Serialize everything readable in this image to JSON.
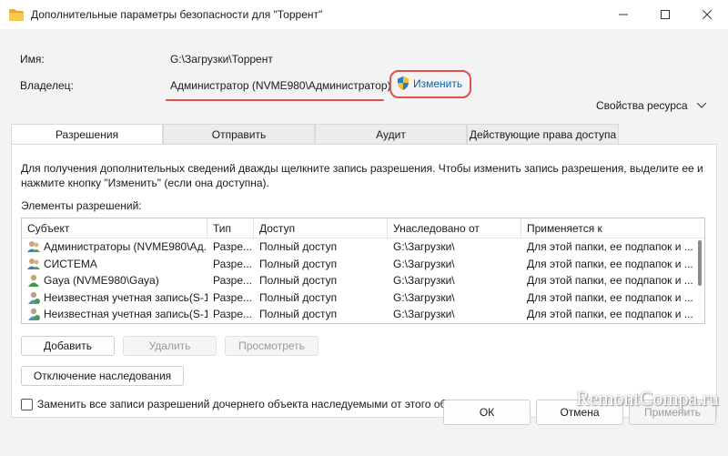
{
  "window": {
    "title": "Дополнительные параметры безопасности  для \"Торрент\"",
    "title_icon": "folder-icon",
    "controls": [
      "minimize-icon",
      "maximize-icon",
      "close-icon"
    ]
  },
  "info": {
    "name_label": "Имя:",
    "name_value": "G:\\Загрузки\\Торрент",
    "owner_label": "Владелец:",
    "owner_value": "Администратор (NVME980\\Администратор)",
    "change_link": "Изменить",
    "resource_props": "Свойства ресурса"
  },
  "tabs": [
    {
      "label": "Разрешения",
      "active": true
    },
    {
      "label": "Отправить",
      "active": false
    },
    {
      "label": "Аудит",
      "active": false
    },
    {
      "label": "Действующие права доступа",
      "active": false
    }
  ],
  "panel": {
    "description": "Для получения дополнительных сведений дважды щелкните запись разрешения. Чтобы изменить запись разрешения, выделите ее и нажмите кнопку \"Изменить\" (если она доступна).",
    "list_label": "Элементы разрешений:",
    "columns": [
      "Субъект",
      "Тип",
      "Доступ",
      "Унаследовано от",
      "Применяется к"
    ],
    "rows": [
      {
        "subject": "Администраторы (NVME980\\Ад...",
        "type": "Разре...",
        "access": "Полный доступ",
        "inherited": "G:\\Загрузки\\",
        "applies": "Для этой папки, ее подпапок и ...",
        "icon": "group-icon"
      },
      {
        "subject": "СИСТЕМА",
        "type": "Разре...",
        "access": "Полный доступ",
        "inherited": "G:\\Загрузки\\",
        "applies": "Для этой папки, ее подпапок и ...",
        "icon": "group-icon"
      },
      {
        "subject": "Gaya (NVME980\\Gaya)",
        "type": "Разре...",
        "access": "Полный доступ",
        "inherited": "G:\\Загрузки\\",
        "applies": "Для этой папки, ее подпапок и ...",
        "icon": "user-icon"
      },
      {
        "subject": "Неизвестная учетная запись(S-1...",
        "type": "Разре...",
        "access": "Полный доступ",
        "inherited": "G:\\Загрузки\\",
        "applies": "Для этой папки, ее подпапок и ...",
        "icon": "unknown-user-icon"
      },
      {
        "subject": "Неизвестная учетная запись(S-1...",
        "type": "Разре...",
        "access": "Полный доступ",
        "inherited": "G:\\Загрузки\\",
        "applies": "Для этой папки, ее подпапок и ...",
        "icon": "unknown-user-icon"
      }
    ],
    "add_button": "Добавить",
    "remove_button": "Удалить",
    "view_button": "Просмотреть",
    "disable_inheritance_button": "Отключение наследования",
    "replace_checkbox": "Заменить все записи разрешений дочернего объекта наследуемыми от этого объекта",
    "replace_checked": false
  },
  "footer": {
    "ok": "ОК",
    "cancel": "Отмена",
    "apply": "Применить"
  },
  "watermark": "RemontCompa.ru",
  "colors": {
    "accent": "#0066b4",
    "highlight": "#d9534f",
    "background": "#f3f3f3"
  }
}
